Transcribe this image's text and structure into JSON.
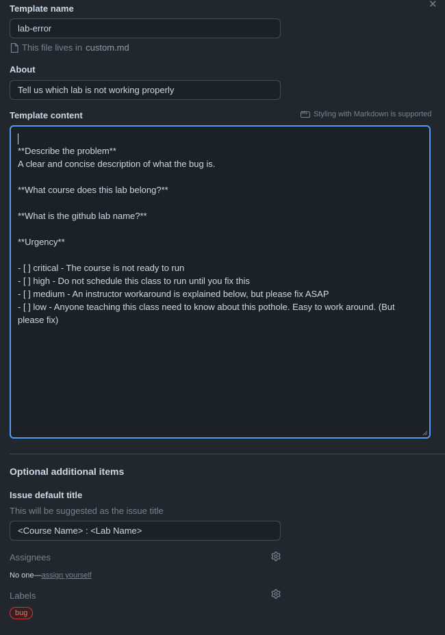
{
  "close_icon": "✕",
  "template_name": {
    "label": "Template name",
    "value": "lab-error",
    "file_hint_prefix": "This file lives in",
    "file_name": "custom.md"
  },
  "about": {
    "label": "About",
    "value": "Tell us which lab is not working properly"
  },
  "template_content": {
    "label": "Template content",
    "markdown_hint": "Styling with Markdown is supported",
    "lines": [
      "",
      "**Describe the problem**",
      "A clear and concise description of what the bug is.",
      "",
      "**What course does this lab belong?**",
      "",
      "**What is the github lab name?**",
      "",
      "**Urgency**",
      "",
      "- [ ] critical - The course is not ready to run",
      "- [ ] high - Do not schedule this class to run until you fix this",
      "- [ ] medium - An instructor workaround is explained below, but please fix ASAP",
      "- [ ] low - Anyone teaching this class need to know about this pothole. Easy to work around. (But please fix)"
    ]
  },
  "optional": {
    "title": "Optional additional items",
    "issue_title": {
      "label": "Issue default title",
      "hint": "This will be suggested as the issue title",
      "value": "<Course Name> : <Lab Name>"
    },
    "assignees": {
      "label": "Assignees",
      "none_text": "No one—",
      "assign_link": "assign yourself"
    },
    "labels": {
      "label": "Labels",
      "badge": "bug"
    }
  },
  "icons": {
    "close": "close-icon",
    "file": "file-icon",
    "markdown": "markdown-icon",
    "gear": "gear-icon"
  },
  "colors": {
    "background": "#22272e",
    "accent_border": "#539bf5",
    "bug_badge": "#f47067"
  }
}
